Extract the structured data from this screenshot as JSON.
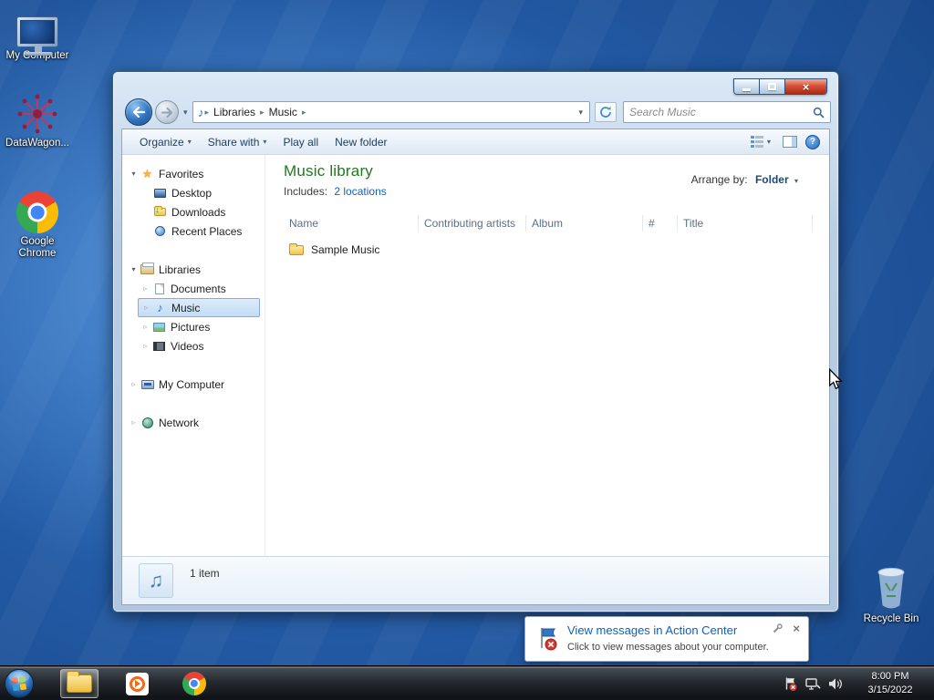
{
  "icons": {
    "close": "×",
    "dropdown": "▾",
    "breadcrumb_sep": "▸",
    "expander_open": "▾",
    "expander_closed": "▹",
    "star": "★",
    "note": "♪",
    "beamed_note": "♫",
    "help": "?",
    "down_arrow": "↓"
  },
  "desktop": {
    "icons": [
      {
        "label": "My Computer"
      },
      {
        "label": "DataWagon..."
      },
      {
        "label": "Google Chrome"
      },
      {
        "label": "Recycle Bin"
      }
    ]
  },
  "window": {
    "nav": {
      "breadcrumbs": [
        "Libraries",
        "Music"
      ],
      "search_placeholder": "Search Music"
    },
    "toolbar": {
      "organize": "Organize",
      "share_with": "Share with",
      "play_all": "Play all",
      "new_folder": "New folder"
    },
    "sidebar": {
      "favorites_label": "Favorites",
      "favorites": [
        "Desktop",
        "Downloads",
        "Recent Places"
      ],
      "libraries_label": "Libraries",
      "libraries": [
        "Documents",
        "Music",
        "Pictures",
        "Videos"
      ],
      "computer_label": "My Computer",
      "network_label": "Network"
    },
    "main": {
      "title": "Music library",
      "includes_label": "Includes:",
      "includes_link": "2 locations",
      "arrange_label": "Arrange by:",
      "arrange_value": "Folder",
      "columns": [
        "Name",
        "Contributing artists",
        "Album",
        "#",
        "Title"
      ],
      "items": [
        {
          "name": "Sample Music"
        }
      ]
    },
    "status": {
      "count": "1 item"
    }
  },
  "notification": {
    "title": "View messages in Action Center",
    "body": "Click to view messages about your computer."
  },
  "taskbar": {
    "time": "8:00 PM",
    "date": "3/15/2022"
  }
}
